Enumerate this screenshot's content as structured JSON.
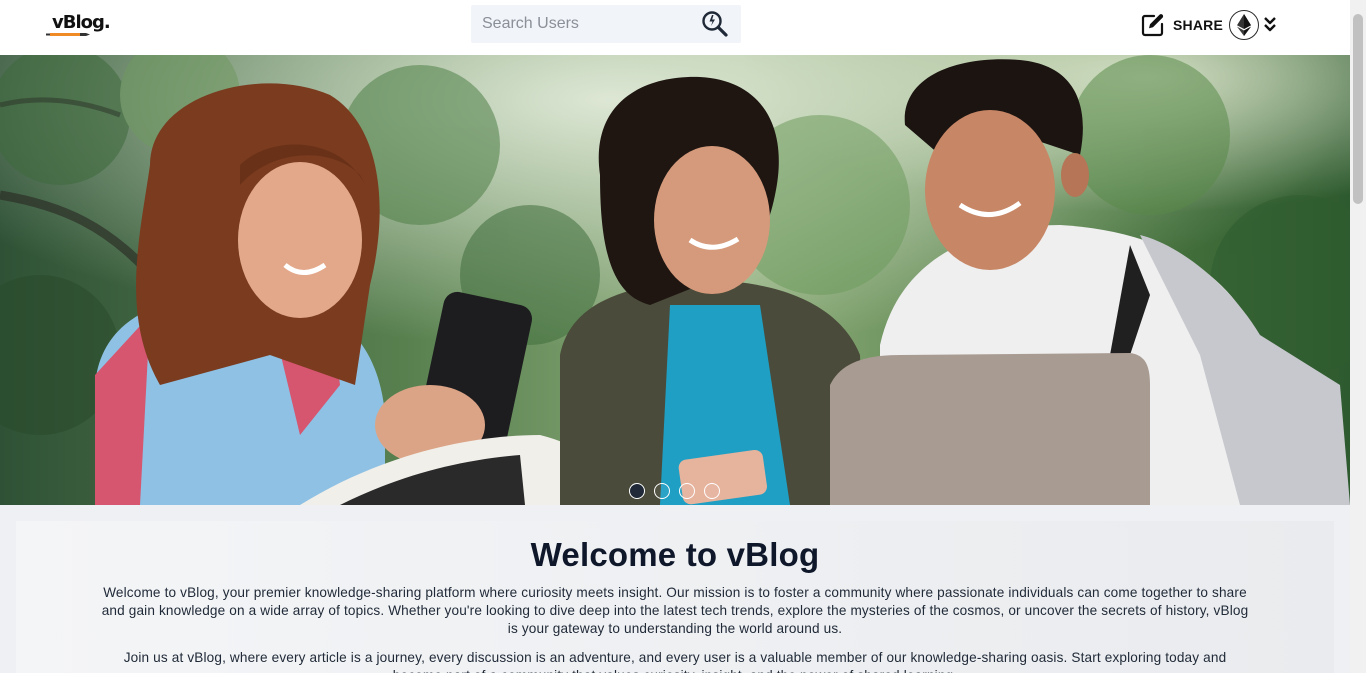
{
  "header": {
    "logo_text": "vBlog.",
    "search": {
      "placeholder": "Search Users"
    },
    "share_label": "SHARE"
  },
  "hero": {
    "carousel": {
      "slide_count": 4,
      "active_index": 0
    }
  },
  "welcome": {
    "title": "Welcome to vBlog",
    "paragraph1": "Welcome to vBlog, your premier knowledge-sharing platform where curiosity meets insight. Our mission is to foster a community where passionate individuals can come together to share and gain knowledge on a wide array of topics. Whether you're looking to dive deep into the latest tech trends, explore the mysteries of the cosmos, or uncover the secrets of history, vBlog is your gateway to understanding the world around us.",
    "paragraph2": "Join us at vBlog, where every article is a journey, every discussion is an adventure, and every user is a valuable member of our knowledge-sharing oasis. Start exploring today and become part of a community that values curiosity, insight, and the power of shared learning."
  },
  "icons": {
    "search": "search-icon",
    "share": "edit-square-icon",
    "avatar": "ethereum-icon",
    "menu": "double-chevron-down-icon"
  },
  "colors": {
    "header_bg": "#ffffff",
    "search_bg": "#f1f4f8",
    "content_bg": "#eef0f3",
    "title_color": "#0f172a",
    "text_color": "#1f2937",
    "logo_pen_orange": "#f08a24"
  }
}
